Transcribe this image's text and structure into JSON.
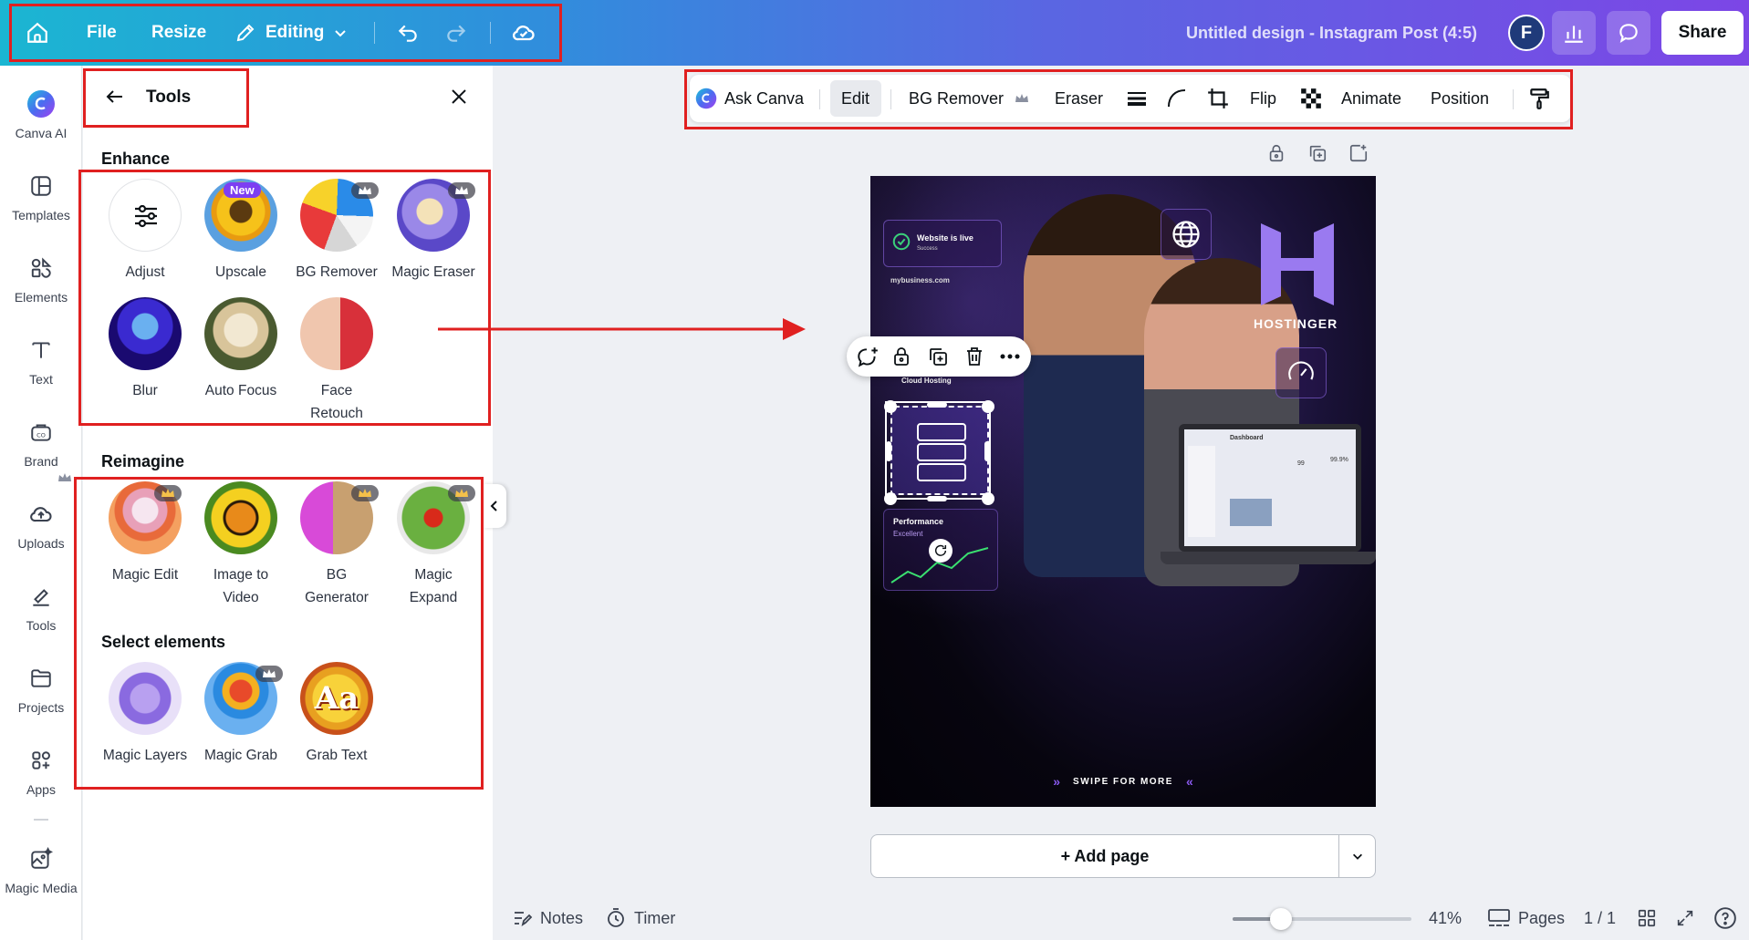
{
  "topbar": {
    "file_label": "File",
    "resize_label": "Resize",
    "editing_label": "Editing",
    "doc_title": "Untitled design - Instagram Post (4:5)",
    "avatar_letter": "F",
    "share_label": "Share"
  },
  "rail": {
    "items": [
      {
        "label": "Canva AI",
        "icon": "canva-ai-icon"
      },
      {
        "label": "Templates",
        "icon": "templates-icon"
      },
      {
        "label": "Elements",
        "icon": "elements-icon"
      },
      {
        "label": "Text",
        "icon": "text-icon"
      },
      {
        "label": "Brand",
        "icon": "brand-icon"
      },
      {
        "label": "Uploads",
        "icon": "uploads-icon"
      },
      {
        "label": "Tools",
        "icon": "tools-icon"
      },
      {
        "label": "Projects",
        "icon": "projects-icon"
      },
      {
        "label": "Apps",
        "icon": "apps-icon"
      },
      {
        "label": "Magic Media",
        "icon": "magic-media-icon"
      }
    ]
  },
  "panel": {
    "title": "Tools",
    "enhance": {
      "title": "Enhance",
      "tools": [
        {
          "label": "Adjust"
        },
        {
          "label": "Upscale",
          "badge": "New"
        },
        {
          "label": "BG Remover"
        },
        {
          "label": "Magic Eraser"
        },
        {
          "label": "Blur"
        },
        {
          "label": "Auto Focus"
        },
        {
          "label_line1": "Face",
          "label_line2": "Retouch"
        }
      ]
    },
    "reimagine": {
      "title": "Reimagine",
      "tools": [
        {
          "label": "Magic Edit"
        },
        {
          "label_line1": "Image to",
          "label_line2": "Video"
        },
        {
          "label_line1": "BG",
          "label_line2": "Generator"
        },
        {
          "label_line1": "Magic",
          "label_line2": "Expand"
        }
      ]
    },
    "select": {
      "title": "Select elements",
      "tools": [
        {
          "label": "Magic Layers"
        },
        {
          "label": "Magic Grab"
        },
        {
          "label": "Grab Text"
        }
      ]
    }
  },
  "context_toolbar": {
    "ask_canva": "Ask Canva",
    "edit": "Edit",
    "bg_remover": "BG Remover",
    "eraser": "Eraser",
    "flip": "Flip",
    "animate": "Animate",
    "position": "Position"
  },
  "design": {
    "website_live": "Website is live",
    "success": "Success",
    "domain": "mybusiness.com",
    "brand": "HOSTINGER",
    "cloud_hosting": "Cloud Hosting",
    "performance": "Performance",
    "excellent": "Excellent",
    "dashboard": "Dashboard",
    "stat_value": "99",
    "stat_pct": "99.9%",
    "swipe": "SWIPE FOR MORE"
  },
  "canvas": {
    "add_page": "+ Add page"
  },
  "bottom": {
    "notes": "Notes",
    "timer": "Timer",
    "zoom_level": "41%",
    "zoom_fraction": 0.27,
    "pages": "Pages",
    "page_count": "1 / 1"
  },
  "colors": {
    "accent_purple": "#7d3ef2",
    "highlight_red": "#e02020"
  }
}
